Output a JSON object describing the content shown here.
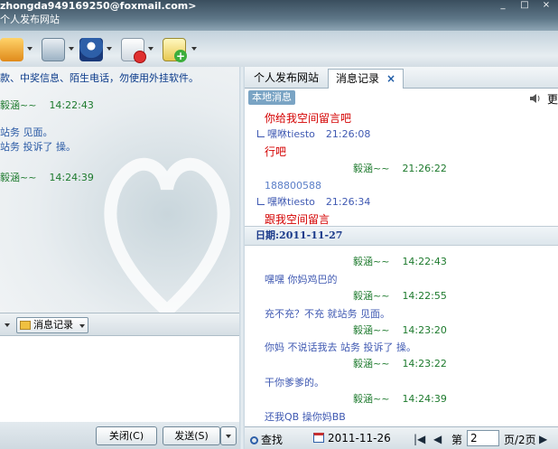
{
  "window": {
    "email": "zhongda949169250@foxmail.com>",
    "subtitle": "个人发布网站",
    "buttons": [
      "_",
      "□",
      "×"
    ]
  },
  "toolbar": {
    "icons": [
      "folder-icon",
      "image-icon",
      "user-icon",
      "block-icon",
      "add-icon"
    ]
  },
  "left": {
    "warning": "款、中奖信息、陌生电话，勿使用外挂软件。",
    "messages": [
      {
        "name": "毅涵~~",
        "time": "14:22:43"
      },
      {
        "text": "站务  见面。"
      },
      {
        "text": "站务 投诉了 操。"
      },
      {
        "name": "毅涵~~",
        "time": "14:24:39"
      }
    ],
    "msg_record_label": "消息记录",
    "close_label": "关闭(C)",
    "send_label": "发送(S)"
  },
  "tabs": [
    {
      "label": "个人发布网站"
    },
    {
      "label": "消息记录",
      "close": "×"
    }
  ],
  "subbar": {
    "local_label": "本地消息",
    "more_label": "更"
  },
  "history": {
    "top": [
      {
        "type": "text",
        "cls": "red",
        "text": "你给我空间留言吧"
      },
      {
        "type": "name",
        "cls": "blue",
        "name": "嘿咻tiesto",
        "time": "21:26:08"
      },
      {
        "type": "text",
        "cls": "red",
        "text": "行吧"
      },
      {
        "type": "name",
        "cls": "green",
        "name": "毅涵~~",
        "time": "21:26:22"
      },
      {
        "type": "text",
        "cls": "num",
        "text": "188800588"
      },
      {
        "type": "name",
        "cls": "blue",
        "name": "嘿咻tiesto",
        "time": "21:26:34"
      },
      {
        "type": "text",
        "cls": "red",
        "text": "跟我空间留言"
      }
    ],
    "date_label": "日期:2011-11-27",
    "bottom": [
      {
        "type": "name",
        "cls": "green",
        "name": "毅涵~~",
        "time": "14:22:43"
      },
      {
        "type": "text",
        "cls": "msg",
        "text": "嘿嘿 你妈鸡巴的"
      },
      {
        "type": "name",
        "cls": "green",
        "name": "毅涵~~",
        "time": "14:22:55"
      },
      {
        "type": "text",
        "cls": "msg",
        "text": "充不充？不充  就站务  见面。"
      },
      {
        "type": "name",
        "cls": "green",
        "name": "毅涵~~",
        "time": "14:23:20"
      },
      {
        "type": "text",
        "cls": "msg",
        "text": "你妈 不说话我去 站务 投诉了 操。"
      },
      {
        "type": "name",
        "cls": "green",
        "name": "毅涵~~",
        "time": "14:23:22"
      },
      {
        "type": "text",
        "cls": "msg",
        "text": "干你爹爹的。"
      },
      {
        "type": "name",
        "cls": "green",
        "name": "毅涵~~",
        "time": "14:24:39"
      },
      {
        "type": "text",
        "cls": "msg",
        "text": "还我QB 操你妈BB"
      }
    ]
  },
  "footer": {
    "search_label": "查找",
    "date": "2011-11-26",
    "page_label": "第",
    "page_value": "2",
    "total_label": "页/2页"
  }
}
